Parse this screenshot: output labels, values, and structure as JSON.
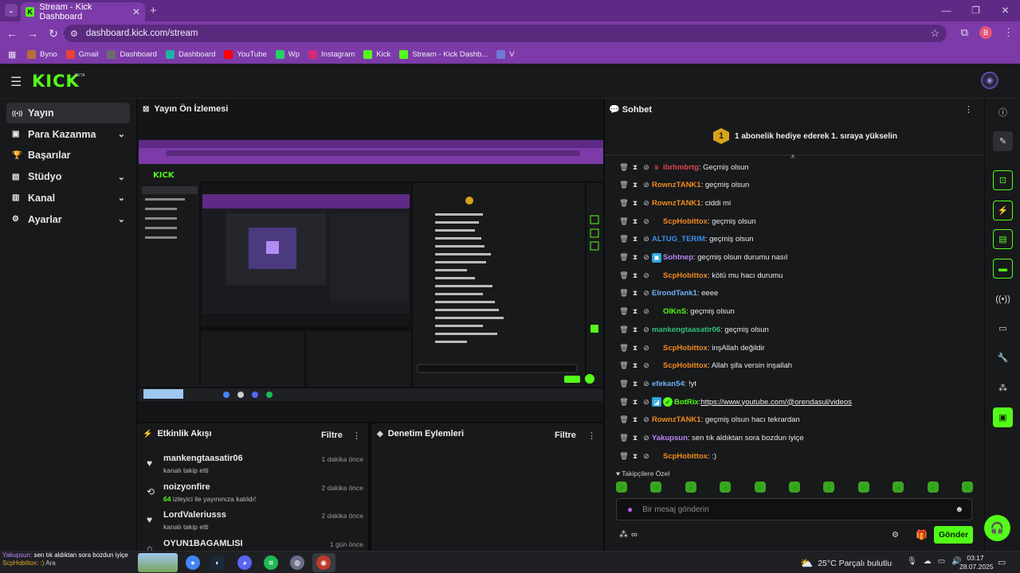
{
  "browser": {
    "tab_title": "Stream - Kick Dashboard",
    "url": "dashboard.kick.com/stream",
    "profile_initial": "B",
    "bookmarks": [
      {
        "label": "Byno",
        "color": "#b86d3a"
      },
      {
        "label": "Gmail",
        "color": "#ea4335"
      },
      {
        "label": "Dashboard",
        "color": "#6c6c6c"
      },
      {
        "label": "Dashboard",
        "color": "#1db3a6"
      },
      {
        "label": "YouTube",
        "color": "#ff0000"
      },
      {
        "label": "Wp",
        "color": "#25d366"
      },
      {
        "label": "Instagram",
        "color": "#d62976"
      },
      {
        "label": "Kick",
        "color": "#53fc18"
      },
      {
        "label": "Stream - Kick Dashb...",
        "color": "#53fc18"
      },
      {
        "label": "V",
        "color": "#6f7bd6"
      }
    ]
  },
  "kick": {
    "logo": "KICK",
    "beta": "BETA"
  },
  "sidebar": {
    "items": [
      {
        "label": "Yayın",
        "icon": "broadcast-icon",
        "active": true
      },
      {
        "label": "Para Kazanma",
        "icon": "wallet-icon",
        "chevron": true
      },
      {
        "label": "Başarılar",
        "icon": "trophy-icon"
      },
      {
        "label": "Stüdyo",
        "icon": "studio-icon",
        "chevron": true
      },
      {
        "label": "Kanal",
        "icon": "channel-icon",
        "chevron": true
      },
      {
        "label": "Ayarlar",
        "icon": "gear-icon",
        "chevron": true
      }
    ]
  },
  "preview": {
    "title": "Yayın Ön İzlemesi"
  },
  "activity": {
    "title": "Etkinlik Akışı",
    "filter": "Filtre",
    "items": [
      {
        "name": "mankengtaasatir06",
        "sub": "kanalı takip etti",
        "time": "1 dakika önce",
        "icon": "heart-icon"
      },
      {
        "name": "noizyonfire",
        "count": "64",
        "sub": "izleyici ile yayınınıza katıldı!",
        "time": "2 dakika önce",
        "icon": "raid-icon"
      },
      {
        "name": "LordValeriusss",
        "sub": "kanalı takip etti",
        "time": "2 dakika önce",
        "icon": "heart-icon"
      },
      {
        "name": "OYUN1BAGAMLISI",
        "sub": "",
        "time": "1 gün önce",
        "icon": "gift-icon"
      }
    ]
  },
  "moderation": {
    "title": "Denetim Eylemleri",
    "filter": "Filtre"
  },
  "chat": {
    "title": "Sohbet",
    "goal_badge": "1",
    "goal_text": "1 abonelik hediye ederek 1. sıraya yükselin",
    "messages": [
      {
        "user": "ibrhmbrtg",
        "color": "#e0454f",
        "text": ": Geçmiş olsun",
        "badge": "crown"
      },
      {
        "user": "RownzTANK1",
        "color": "#f08b1c",
        "text": ": geçmiş olsun"
      },
      {
        "user": "RownzTANK1",
        "color": "#f08b1c",
        "text": ": ciddi mi"
      },
      {
        "user": "ScpHobittox",
        "color": "#f08b1c",
        "text": ": geçmiş olsun",
        "indent": true
      },
      {
        "user": "ALTUG_TERIM",
        "color": "#3b8ef0",
        "text": ": geçmiş olsun"
      },
      {
        "user": "Sohtnep",
        "color": "#b886f5",
        "text": ": geçmiş olsun durumu nasıl",
        "badge": "sub"
      },
      {
        "user": "ScpHobittox",
        "color": "#f08b1c",
        "text": ": kötü mu hacı durumu",
        "indent": true
      },
      {
        "user": "ElrondTank1",
        "color": "#6fb2f5",
        "text": ": eeee"
      },
      {
        "user": "OlKnS",
        "color": "#53fc18",
        "text": ": geçmiş olsun",
        "indent": true
      },
      {
        "user": "mankengtaasatir06",
        "color": "#2ec27e",
        "text": ": geçmiş olsun"
      },
      {
        "user": "ScpHobittox",
        "color": "#f08b1c",
        "text": ": inşAllah değildir",
        "indent": true
      },
      {
        "user": "ScpHobittox",
        "color": "#f08b1c",
        "text": ": Allah şifa versin inşallah",
        "indent": true
      },
      {
        "user": "efekan54",
        "color": "#6fb2f5",
        "text": ": !yt"
      },
      {
        "user": "BotRix",
        "color": "#53fc18",
        "text": ": ",
        "link": "https://www.youtube.com/@orendasul/videos",
        "badge": "bot"
      },
      {
        "user": "RownzTANK1",
        "color": "#f08b1c",
        "text": ": geçmiş olsun hacı tekrardan"
      },
      {
        "user": "Yakupsun",
        "color": "#b886f5",
        "text": ": sen tık aldıktan sora bozdun iyiçe"
      },
      {
        "user": "ScpHobittox",
        "color": "#f08b1c",
        "text": ": :)",
        "indent": true
      }
    ],
    "followers_only": "Takipçilere Özel",
    "input_placeholder": "Bir mesaj gönderin",
    "send_label": "Gönder",
    "footer_symbol": "∞"
  },
  "taskbar": {
    "overlay_line1_user": "Yakupsun:",
    "overlay_line1_text": " sen tık aldıktan sora bozdun iyiçe",
    "overlay_line2": "ScpHobittox: :)",
    "search": "Ara",
    "weather": "25°C  Parçalı bulutlu",
    "time": "03:17",
    "date": "28.07.2025"
  }
}
